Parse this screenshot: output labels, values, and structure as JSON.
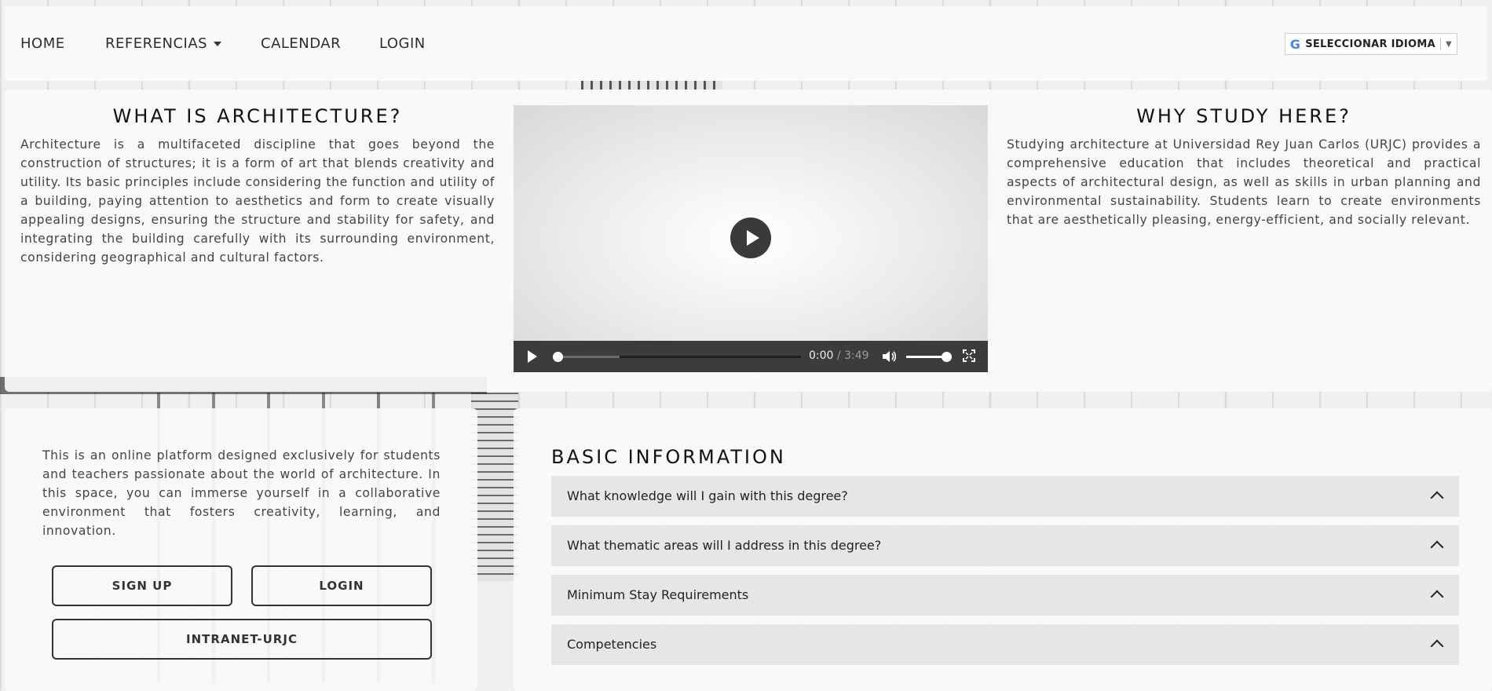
{
  "nav": {
    "items": [
      {
        "label": "HOME"
      },
      {
        "label": "REFERENCIAS"
      },
      {
        "label": "CALENDAR"
      },
      {
        "label": "LOGIN"
      }
    ],
    "language": {
      "label": "SELECCIONAR IDIOMA",
      "icon": "google-g-icon"
    }
  },
  "what": {
    "title": "WHAT IS ARCHITECTURE?",
    "text": "Architecture is a multifaceted discipline that goes beyond the construction of structures; it is a form of art that blends creativity and utility. Its basic principles include considering the function and utility of a building, paying attention to aesthetics and form to create visually appealing designs, ensuring the structure and stability for safety, and integrating the building carefully with its surrounding environment, considering geographical and cultural factors."
  },
  "video": {
    "current_time": "0:00",
    "duration": "3:49",
    "progress_fraction": 0.0,
    "buffered_fraction": 0.26,
    "volume_fraction": 1.0
  },
  "why": {
    "title": "WHY STUDY HERE?",
    "text": "Studying architecture at Universidad Rey Juan Carlos (URJC) provides a comprehensive education that includes theoretical and practical aspects of architectural design, as well as skills in urban planning and environmental sustainability. Students learn to create environments that are aesthetically pleasing, energy-efficient, and socially relevant."
  },
  "intro": {
    "text": "This is an online platform designed exclusively for students and teachers passionate about the world of architecture. In this space, you can immerse yourself in a collaborative environment that fosters creativity, learning, and innovation.",
    "signup_label": "SIGN UP",
    "login_label": "LOGIN",
    "intranet_label": "INTRANET-URJC"
  },
  "basic": {
    "title": "BASIC INFORMATION",
    "items": [
      {
        "label": "What knowledge will I gain with this degree?"
      },
      {
        "label": "What thematic areas will I address in this degree?"
      },
      {
        "label": "Minimum Stay Requirements"
      },
      {
        "label": "Competencies"
      }
    ]
  }
}
